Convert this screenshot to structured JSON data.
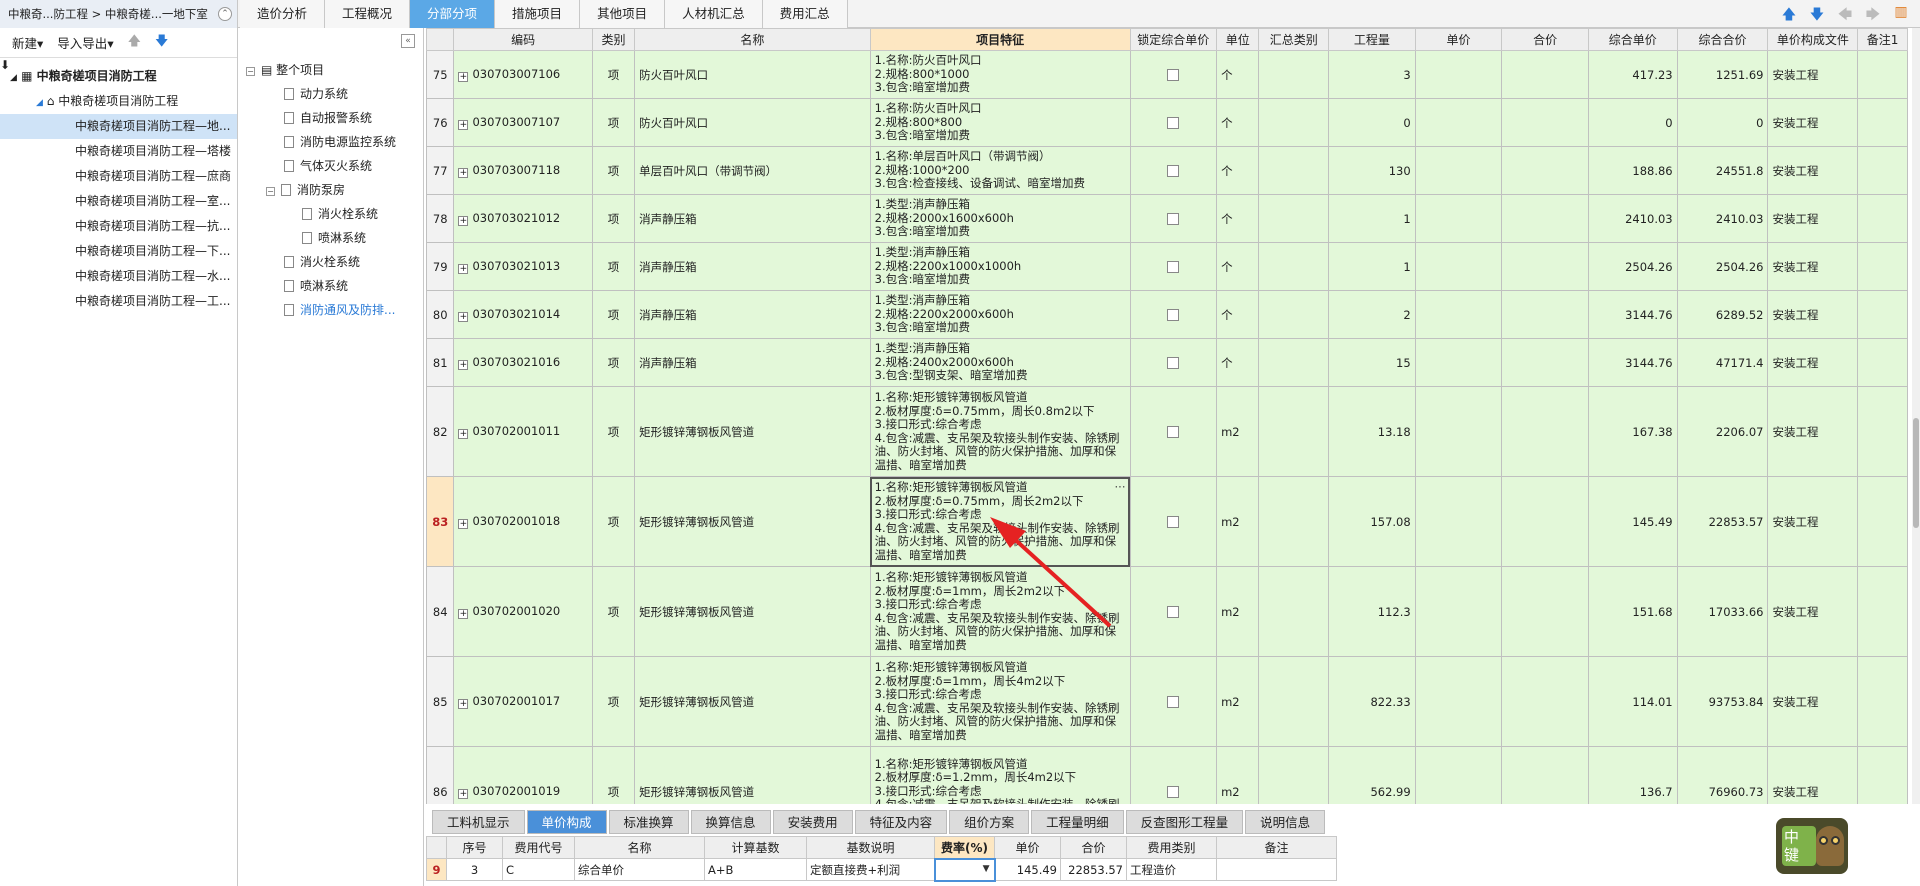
{
  "breadcrumb": {
    "text": "中粮奇...防工程 > 中粮奇槎...一地下室"
  },
  "tabs": [
    "造价分析",
    "工程概况",
    "分部分项",
    "措施项目",
    "其他项目",
    "人材机汇总",
    "费用汇总"
  ],
  "active_tab": "分部分项",
  "left_toolbar": {
    "new": "新建",
    "import_export": "导入导出"
  },
  "project_tree": {
    "root": "中粮奇槎项目消防工程",
    "child": "中粮奇槎项目消防工程",
    "items": [
      "中粮奇槎项目消防工程—地...",
      "中粮奇槎项目消防工程—塔楼",
      "中粮奇槎项目消防工程—庶商",
      "中粮奇槎项目消防工程—室...",
      "中粮奇槎项目消防工程—抗...",
      "中粮奇槎项目消防工程—下...",
      "中粮奇槎项目消防工程—水...",
      "中粮奇槎项目消防工程—工..."
    ]
  },
  "section_tree": {
    "root": "整个项目",
    "items": [
      "动力系统",
      "自动报警系统",
      "消防电源监控系统",
      "气体灭火系统",
      "消防泵房",
      "消火栓系统",
      "喷淋系统",
      "消火栓系统",
      "喷淋系统",
      "消防通风及防排..."
    ]
  },
  "grid": {
    "headers": [
      "编码",
      "类别",
      "名称",
      "项目特征",
      "锁定综合单价",
      "单位",
      "汇总类别",
      "工程量",
      "单价",
      "合价",
      "综合单价",
      "综合合价",
      "单价构成文件",
      "备注1"
    ],
    "rows": [
      {
        "no": "75",
        "code": "030703007106",
        "type": "项",
        "name": "防火百叶风口",
        "feature": "1.名称:防火百叶风口\n2.规格:800*1000\n3.包含:暗室增加费",
        "unit": "个",
        "qty": "3",
        "comp_price": "417.23",
        "comp_total": "1251.69",
        "file": "安装工程"
      },
      {
        "no": "76",
        "code": "030703007107",
        "type": "项",
        "name": "防火百叶风口",
        "feature": "1.名称:防火百叶风口\n2.规格:800*800\n3.包含:暗室增加费",
        "unit": "个",
        "qty": "0",
        "comp_price": "0",
        "comp_total": "0",
        "file": "安装工程"
      },
      {
        "no": "77",
        "code": "030703007118",
        "type": "项",
        "name": "单层百叶风口（带调节阀）",
        "feature": "1.名称:单层百叶风口（带调节阀）\n2.规格:1000*200\n3.包含:检查接线、设备调试、暗室增加费",
        "unit": "个",
        "qty": "130",
        "comp_price": "188.86",
        "comp_total": "24551.8",
        "file": "安装工程"
      },
      {
        "no": "78",
        "code": "030703021012",
        "type": "项",
        "name": "消声静压箱",
        "feature": "1.类型:消声静压箱\n2.规格:2000x1600x600h\n3.包含:暗室增加费",
        "unit": "个",
        "qty": "1",
        "comp_price": "2410.03",
        "comp_total": "2410.03",
        "file": "安装工程"
      },
      {
        "no": "79",
        "code": "030703021013",
        "type": "项",
        "name": "消声静压箱",
        "feature": "1.类型:消声静压箱\n2.规格:2200x1000x1000h\n3.包含:暗室增加费",
        "unit": "个",
        "qty": "1",
        "comp_price": "2504.26",
        "comp_total": "2504.26",
        "file": "安装工程"
      },
      {
        "no": "80",
        "code": "030703021014",
        "type": "项",
        "name": "消声静压箱",
        "feature": "1.类型:消声静压箱\n2.规格:2200x2000x600h\n3.包含:暗室增加费",
        "unit": "个",
        "qty": "2",
        "comp_price": "3144.76",
        "comp_total": "6289.52",
        "file": "安装工程"
      },
      {
        "no": "81",
        "code": "030703021016",
        "type": "项",
        "name": "消声静压箱",
        "feature": "1.类型:消声静压箱\n2.规格:2400x2000x600h\n3.包含:型钢支架、暗室增加费",
        "unit": "个",
        "qty": "15",
        "comp_price": "3144.76",
        "comp_total": "47171.4",
        "file": "安装工程"
      },
      {
        "no": "82",
        "code": "030702001011",
        "type": "项",
        "name": "矩形镀锌薄钢板风管道",
        "feature": "1.名称:矩形镀锌薄钢板风管道\n2.板材厚度:δ=0.75mm，周长0.8m2以下\n3.接口形式:综合考虑\n4.包含:减震、支吊架及软接头制作安装、除锈刷油、防火封堵、风管的防火保护措施、加厚和保温措、暗室增加费",
        "unit": "m2",
        "qty": "13.18",
        "comp_price": "167.38",
        "comp_total": "2206.07",
        "file": "安装工程"
      },
      {
        "no": "83",
        "code": "030702001018",
        "type": "项",
        "name": "矩形镀锌薄钢板风管道",
        "feature": "1.名称:矩形镀锌薄钢板风管道\n2.板材厚度:δ=0.75mm，周长2m2以下\n3.接口形式:综合考虑\n4.包含:减震、支吊架及软接头制作安装、除锈刷油、防火封堵、风管的防火保护措施、加厚和保温措、暗室增加费",
        "unit": "m2",
        "qty": "157.08",
        "comp_price": "145.49",
        "comp_total": "22853.57",
        "file": "安装工程"
      },
      {
        "no": "84",
        "code": "030702001020",
        "type": "项",
        "name": "矩形镀锌薄钢板风管道",
        "feature": "1.名称:矩形镀锌薄钢板风管道\n2.板材厚度:δ=1mm，周长2m2以下\n3.接口形式:综合考虑\n4.包含:减震、支吊架及软接头制作安装、除锈刷油、防火封堵、风管的防火保护措施、加厚和保温措、暗室增加费",
        "unit": "m2",
        "qty": "112.3",
        "comp_price": "151.68",
        "comp_total": "17033.66",
        "file": "安装工程"
      },
      {
        "no": "85",
        "code": "030702001017",
        "type": "项",
        "name": "矩形镀锌薄钢板风管道",
        "feature": "1.名称:矩形镀锌薄钢板风管道\n2.板材厚度:δ=1mm，周长4m2以下\n3.接口形式:综合考虑\n4.包含:减震、支吊架及软接头制作安装、除锈刷油、防火封堵、风管的防火保护措施、加厚和保温措、暗室增加费",
        "unit": "m2",
        "qty": "822.33",
        "comp_price": "114.01",
        "comp_total": "93753.84",
        "file": "安装工程"
      },
      {
        "no": "86",
        "code": "030702001019",
        "type": "项",
        "name": "矩形镀锌薄钢板风管道",
        "feature": "1.名称:矩形镀锌薄钢板风管道\n2.板材厚度:δ=1.2mm，周长4m2以下\n3.接口形式:综合考虑\n4.包含:减震、支吊架及软接头制作安装、除锈刷油、防火封堵、风管的防火保护措施、加",
        "unit": "m2",
        "qty": "562.99",
        "comp_price": "136.7",
        "comp_total": "76960.73",
        "file": "安装工程"
      }
    ]
  },
  "bottom_tabs": [
    "工料机显示",
    "单价构成",
    "标准换算",
    "换算信息",
    "安装费用",
    "特征及内容",
    "组价方案",
    "工程量明细",
    "反查图形工程量",
    "说明信息"
  ],
  "active_bottom_tab": "单价构成",
  "bottom_table": {
    "headers": [
      "序号",
      "费用代号",
      "名称",
      "计算基数",
      "基数说明",
      "费率(%)",
      "单价",
      "合价",
      "费用类别",
      "备注"
    ],
    "row": {
      "rownum": "9",
      "seq": "3",
      "code": "C",
      "name": "综合单价",
      "base": "A+B",
      "base_desc": "定额直接费+利润",
      "rate": "",
      "price": "145.49",
      "total": "22853.57",
      "category": "工程造价",
      "remark": ""
    }
  },
  "badge": {
    "text": "中\n键"
  }
}
